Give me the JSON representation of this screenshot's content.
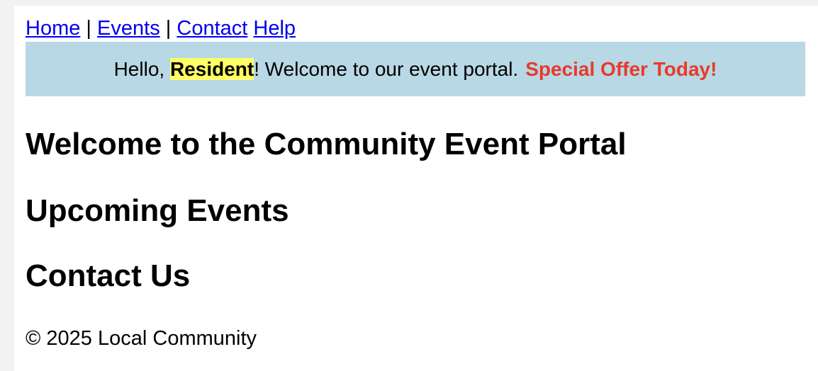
{
  "nav": {
    "links": [
      "Home",
      "Events",
      "Contact",
      "Help"
    ],
    "separator": "|"
  },
  "banner": {
    "greeting": "Hello, ",
    "name": "Resident",
    "message": "! Welcome to our event portal.",
    "offer": "Special Offer Today!",
    "colors": {
      "background": "#b7d8e4",
      "highlight": "#ffff66",
      "offer": "#e83a2a"
    }
  },
  "main": {
    "title": "Welcome to the Community Event Portal",
    "sections": [
      "Upcoming Events",
      "Contact Us"
    ]
  },
  "footer": {
    "text": "© 2025 Local Community"
  }
}
